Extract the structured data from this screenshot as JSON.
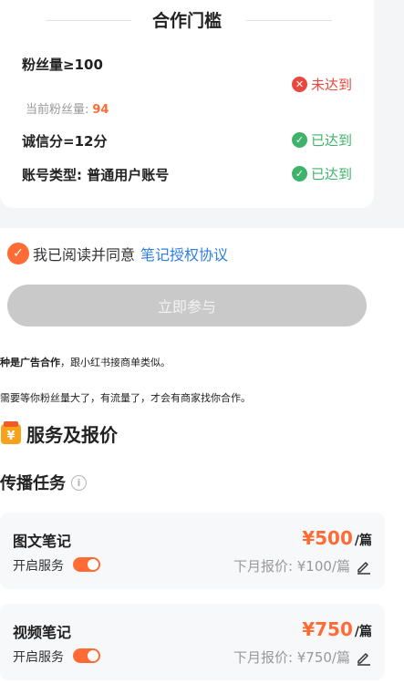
{
  "threshold": {
    "title": "合作门槛",
    "requirements": [
      {
        "label": "粉丝量≥100",
        "status": "未达到"
      },
      {
        "label": "诚信分=12分",
        "status": "已达到"
      },
      {
        "label": "账号类型: 普通用户账号",
        "status": "已达到"
      }
    ],
    "current_fans_label": "当前粉丝量:",
    "current_fans_value": "94"
  },
  "agreement": {
    "text": "我已阅读并同意",
    "link": "笔记授权协议"
  },
  "join_button": "立即参与",
  "notes": {
    "line1_bold": "种是广告合作",
    "line1_rest": "，跟小红书接商单类似。",
    "line2": "需要等你粉丝量大了，有流量了，才会有商家找你合作。"
  },
  "services": {
    "title": "服务及报价",
    "subtitle": "传播任务",
    "info_symbol": "i",
    "items": [
      {
        "name": "图文笔记",
        "toggle_label": "开启服务",
        "price": "¥500",
        "unit": "/篇",
        "next_price": "下月报价: ¥100/篇",
        "enabled": true
      },
      {
        "name": "视频笔记",
        "toggle_label": "开启服务",
        "price": "¥750",
        "unit": "/篇",
        "next_price": "下月报价: ¥750/篇",
        "enabled": true
      }
    ]
  },
  "colors": {
    "accent": "#ff6b35",
    "success": "#3fb36b",
    "error": "#e8483e",
    "link": "#2f7de1",
    "disabled_button": "#c9c9c9"
  },
  "icons": {
    "error": "x-circle-icon",
    "success": "check-circle-icon",
    "agree": "check-circle-icon",
    "section": "price-tag-icon",
    "info": "info-icon",
    "edit": "pencil-icon"
  }
}
